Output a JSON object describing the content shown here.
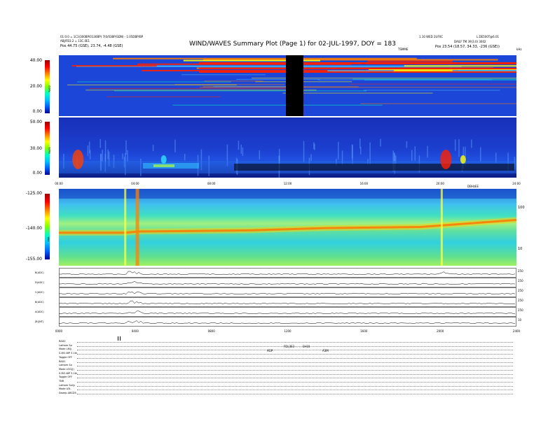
{
  "header": {
    "title": "WIND/WAVES Summary Plot (Page 1) for 02-JUL-1997, DOY = 183",
    "left_line1": "01:0.0 = 1C3(300BP/0130BP) 7(0/03BP(SDN) - 1:05DBP/BP",
    "left_line2": "ABJ/FB3.2 = 13C.0E1",
    "left_pos": "Pos   44.75 (GSE), 23.74, -4.48 (GSE)",
    "right_line0": "L.DE500T@6.01",
    "right_line1": "1.10 WED 2UF0C",
    "right_line2": "DAILY TM 39(3.0) 3002",
    "right_pos": "Pos   23.54 (18.57, 34.33, -236 (GSE))",
    "tsmme": "TSMME",
    "khz": "kHz"
  },
  "panels": {
    "rad2": {
      "label": "RAD2",
      "ticks": [
        "40.00",
        "20.00",
        "0.00"
      ],
      "color_max": 40,
      "color_min": 0
    },
    "rad1": {
      "label": "RAD1",
      "ticks": [
        "50.00",
        "30.00",
        "0.00"
      ],
      "color_max": 50,
      "color_min": 0
    },
    "tnr": {
      "label": "TNR",
      "ticks": [
        "-125.00",
        "-140.00",
        "-155.00"
      ],
      "color_max": -125,
      "color_min": -155,
      "right_ticks": [
        "100",
        "10"
      ],
      "right_label": "DBHzEE"
    }
  },
  "time_axis": {
    "labels": [
      "00:00",
      "04:00",
      "08:00",
      "12:00",
      "16:00",
      "20:00",
      "24:00"
    ]
  },
  "traces": {
    "labels": [
      "B(ADC)",
      "D(ADC)",
      "C(ADC)",
      "B(ADC)",
      "A(ADC)",
      "|B|(NT)"
    ],
    "right_values": [
      "250",
      "250",
      "250",
      "250",
      "250",
      "10"
    ]
  },
  "bottom_time_axis": {
    "labels": [
      "0000",
      "0400",
      "0800",
      "1200",
      "1600",
      "2000",
      "2400"
    ]
  },
  "status_rows": {
    "labels": [
      "RAD2",
      "Lathom   So",
      "Mode   LM(j",
      "S-MO-BIP 3.1th",
      "Toggle   OFF",
      "RAD1",
      "Lathom   So",
      "Mode   LOG(J)",
      "S-MO-BIP 3.1th",
      "Toggle   OFF",
      "TNR",
      "Lathom   Sol(y",
      "Mode   A3L",
      "Sweep   ABCD5"
    ],
    "annotations": [
      "FDL3E3 . . . . 1H10",
      "AGP",
      "A3M"
    ]
  },
  "chart_data": [
    {
      "type": "heatmap",
      "title": "WIND/WAVES Summary Plot (Page 1) for 02-JUL-1997, DOY = 183",
      "xlabel": "",
      "ylabel": "RAD2",
      "x_range_hours": [
        0,
        24
      ],
      "color_range": [
        0,
        40
      ],
      "data_gap_hours": [
        11.9,
        12.8
      ],
      "notable_bands": "intense narrowband emission lines near top of band throughout the day"
    },
    {
      "type": "heatmap",
      "xlabel": "",
      "ylabel": "RAD1",
      "x_range_hours": [
        0,
        24
      ],
      "color_range": [
        0,
        50
      ],
      "bursts_hours": [
        1.0,
        5.5,
        20.3,
        21.2
      ]
    },
    {
      "type": "heatmap",
      "xlabel": "",
      "ylabel": "TNR",
      "x_range_hours": [
        0,
        24
      ],
      "color_range": [
        -155,
        -125
      ],
      "y_ticks_khz": [
        100,
        10
      ],
      "plasma_line_hours": [
        0,
        3.5,
        4.2,
        10,
        14,
        19,
        24
      ],
      "plasma_line_frac": [
        0.38,
        0.38,
        0.37,
        0.36,
        0.34,
        0.33,
        0.27
      ],
      "bursts_hours": [
        3.5,
        4.1,
        20.1
      ]
    }
  ],
  "colors": {
    "colorbar": [
      "#0000a0",
      "#0060ff",
      "#00c0ff",
      "#00ffc0",
      "#80ff00",
      "#ffff00",
      "#ff8000",
      "#ff0000",
      "#a00000"
    ]
  }
}
